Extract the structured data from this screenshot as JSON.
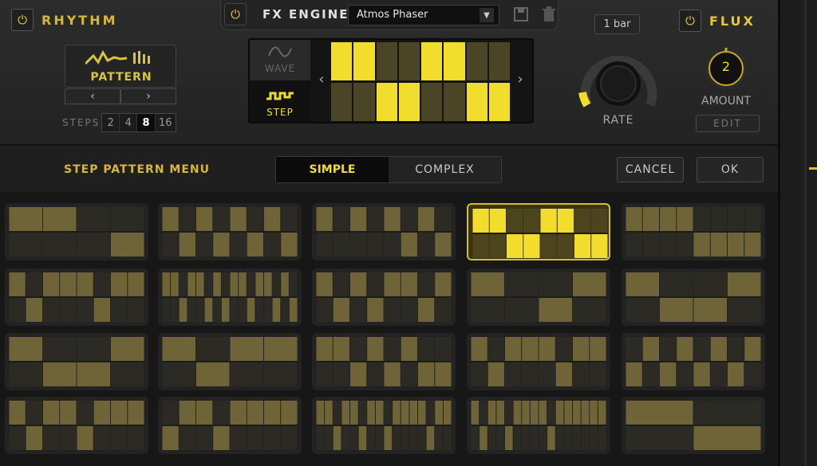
{
  "rhythm": {
    "title": "RHYTHM",
    "pattern_label": "PATTERN",
    "prev": "‹",
    "next": "›",
    "steps_label": "STEPS",
    "steps": [
      "2",
      "4",
      "8",
      "16"
    ],
    "selected_step": "8"
  },
  "fx": {
    "title": "FX ENGINE",
    "preset": "Atmos Phaser",
    "wave_label": "WAVE",
    "step_label": "STEP",
    "prev": "‹",
    "next": "›",
    "steps_top": [
      1,
      1,
      0,
      0,
      1,
      1,
      0,
      0
    ],
    "steps_bottom": [
      0,
      0,
      1,
      1,
      0,
      0,
      1,
      1
    ]
  },
  "rate": {
    "value": "1 bar",
    "label": "RATE"
  },
  "flux": {
    "title": "FLUX",
    "amount": "2",
    "amount_label": "AMOUNT",
    "edit_label": "EDIT"
  },
  "menu": {
    "title": "STEP PATTERN MENU",
    "tabs": [
      "SIMPLE",
      "COMPLEX"
    ],
    "active_tab": "SIMPLE",
    "cancel": "CANCEL",
    "ok": "OK"
  },
  "patterns": [
    [
      1,
      1,
      0,
      -1
    ],
    [
      1,
      -1,
      1,
      -1,
      1,
      -1,
      1,
      -1
    ],
    [
      1,
      0,
      1,
      0,
      1,
      -1,
      1,
      -1
    ],
    [
      1,
      1,
      -1,
      -1,
      1,
      1,
      -1,
      -1
    ],
    [
      1,
      1,
      1,
      1,
      -1,
      -1,
      -1,
      -1
    ],
    [
      1,
      -1,
      1,
      1,
      1,
      -1,
      1,
      1
    ],
    [
      1,
      1,
      -1,
      1,
      1,
      -1,
      1,
      -1,
      1,
      1,
      -1,
      1,
      1,
      -1,
      1,
      -1
    ],
    [
      1,
      -1,
      1,
      -1,
      1,
      1,
      -1,
      1
    ],
    [
      1,
      0,
      -1,
      1
    ],
    [
      1,
      -1,
      -1,
      1
    ],
    [
      1,
      -1,
      -1,
      1
    ],
    [
      1,
      -1,
      1,
      1
    ],
    [
      1,
      1,
      -1,
      1,
      -1,
      1,
      -1,
      -1
    ],
    [
      1,
      -1,
      1,
      1,
      1,
      -1,
      1,
      1
    ],
    [
      -1,
      1,
      -1,
      1,
      -1,
      1,
      -1,
      1
    ],
    [
      1,
      -1,
      1,
      1,
      -1,
      1,
      1,
      1
    ],
    [
      -1,
      1,
      1,
      -1,
      1,
      1,
      1,
      1
    ],
    [
      1,
      1,
      -1,
      1,
      1,
      -1,
      1,
      1,
      -1,
      1,
      1,
      1,
      1,
      -1,
      1,
      1
    ],
    [
      1,
      -1,
      1,
      1,
      -1,
      1,
      1,
      1,
      1,
      -1,
      1,
      1,
      1,
      1,
      1,
      1
    ],
    [
      1,
      -1
    ]
  ],
  "selected_pattern": 3,
  "colors": {
    "accent": "#f2dd2c",
    "dim": "#6e6437",
    "gold_text": "#d8b63a"
  }
}
